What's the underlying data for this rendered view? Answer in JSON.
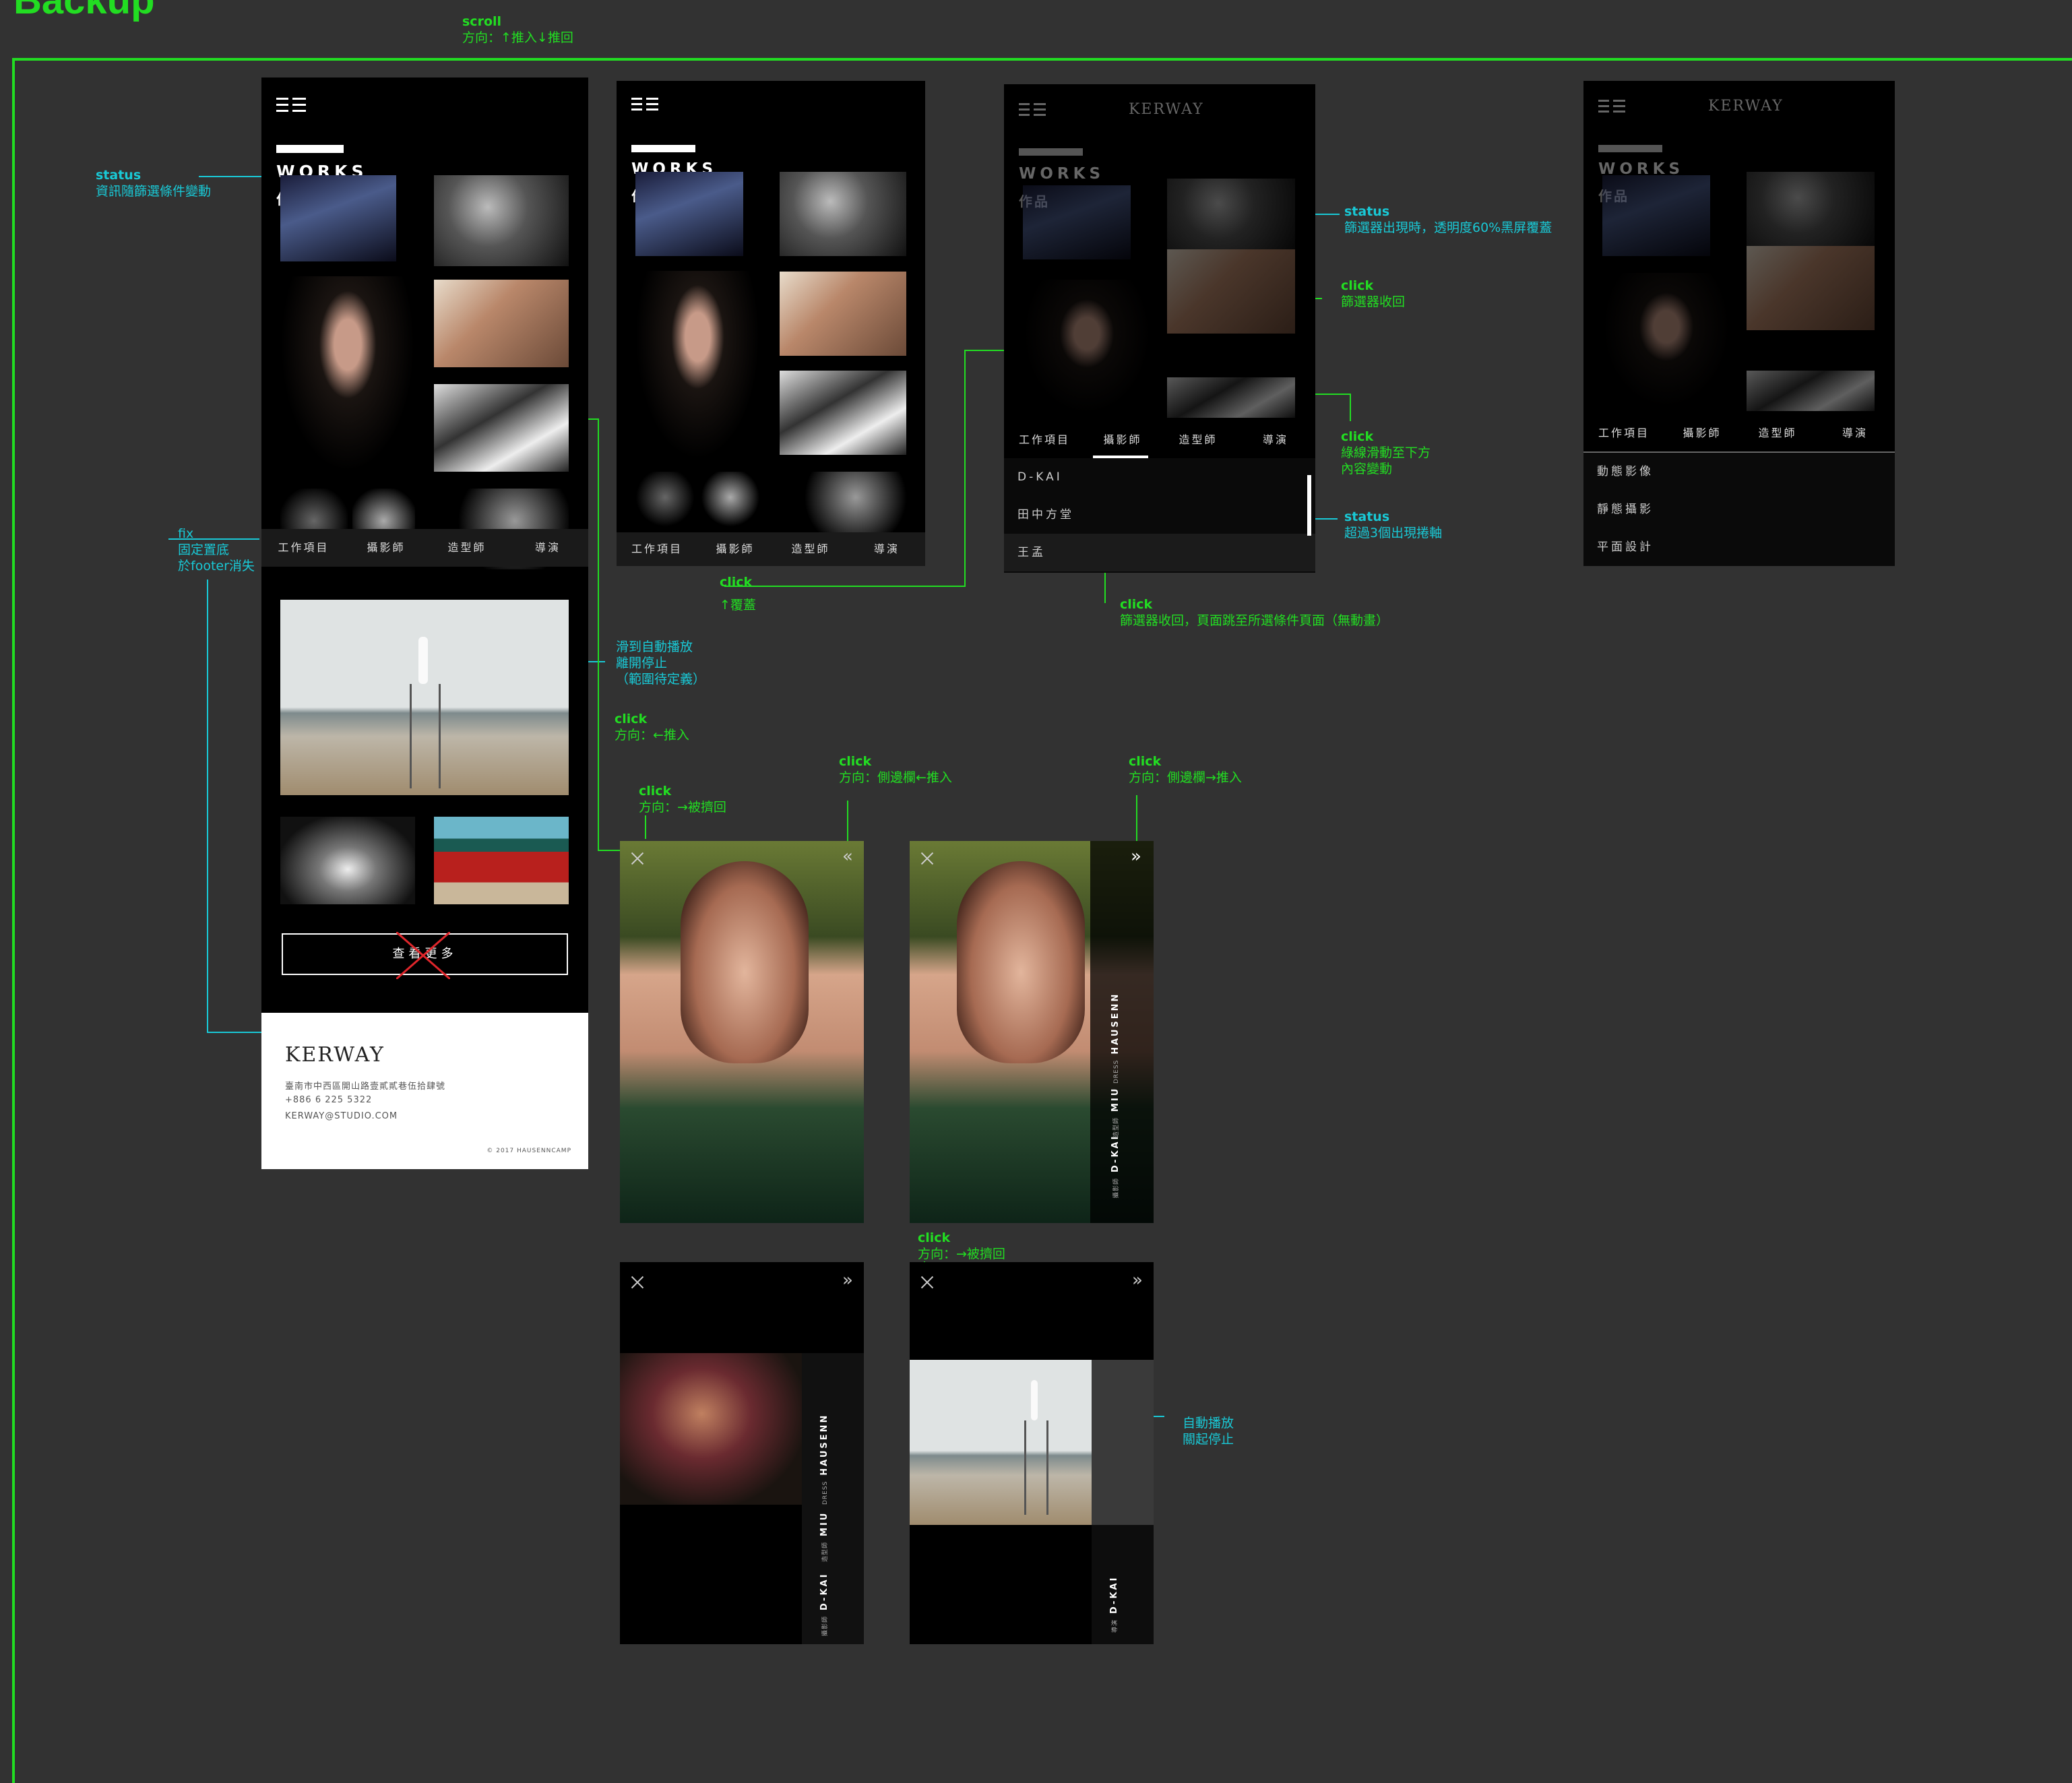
{
  "board": {
    "title": "Backup"
  },
  "notes": {
    "scroll": {
      "head": "scroll",
      "body": "方向：↑推入↓推回"
    },
    "status_filter": {
      "head": "status",
      "body": "資訊隨篩選條件變動"
    },
    "fix": {
      "head": "fix",
      "line2": "固定置底",
      "line3": "於footer消失"
    },
    "autoplay_scroll": {
      "line1": "滑到自動播放",
      "line2": "離開停止",
      "line3": "（範圍待定義）"
    },
    "click_push": {
      "head": "click",
      "body": "方向：←推入"
    },
    "click_pushback": {
      "head": "click",
      "body": "方向：→被擠回"
    },
    "click_side_in": {
      "head": "click",
      "body": "方向：側邊欄←推入"
    },
    "click_side_out": {
      "head": "click",
      "body": "方向：側邊欄→推入"
    },
    "click_cover": {
      "head": "click",
      "body": "↑覆蓋"
    },
    "status_overlay": {
      "head": "status",
      "body": "篩選器出現時，透明度60%黑屏覆蓋"
    },
    "click_collapse": {
      "head": "click",
      "body": "篩選器收回"
    },
    "click_underline": {
      "head": "click",
      "line2": "綠線滑動至下方",
      "line3": "內容變動"
    },
    "status_scroll": {
      "head": "status",
      "body": "超過3個出現捲軸"
    },
    "click_jump": {
      "head": "click",
      "body": "篩選器收回，頁面跳至所選條件頁面（無動畫）"
    },
    "click_pushback2": {
      "head": "click",
      "body": "方向：→被擠回"
    },
    "autoplay_close": {
      "line1": "自動播放",
      "line2": "關起停止"
    }
  },
  "works": {
    "en": "WORKS",
    "zh": "作品"
  },
  "tabs": [
    "工作項目",
    "攝影師",
    "造型師",
    "導演"
  ],
  "filter_photographers": [
    "D-KAI",
    "田中方堂",
    "王孟"
  ],
  "filter_items": [
    "動態影像",
    "靜態攝影",
    "平面設計"
  ],
  "more_button": "查看更多",
  "footer": {
    "logo": "KERWAY",
    "address": "臺南市中西區開山路壹貳貳巷伍拾肆號",
    "phone": "+886 6 225 5322",
    "email": "KERWAY@STUDIO.COM",
    "copyright": "© 2017 HAUSENNCAMP"
  },
  "credits": [
    {
      "role": "DRESS",
      "name": "HAUSENN"
    },
    {
      "role": "造型師",
      "name": "MIU"
    },
    {
      "role": "攝影師",
      "name": "D-KAI"
    }
  ],
  "credits_video": {
    "role": "導演",
    "name": "D-KAI"
  },
  "colors": {
    "background": "#323232",
    "accent_green": "#22dd22",
    "annotation_cyan": "#19c9d6"
  }
}
